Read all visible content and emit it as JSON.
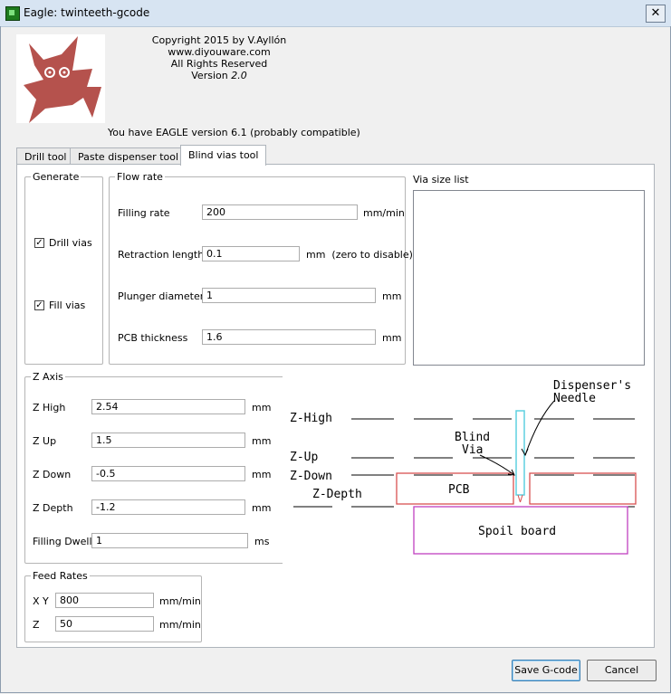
{
  "window": {
    "title": "Eagle: twinteeth-gcode",
    "close": "✕"
  },
  "header": {
    "copyright": "Copyright 2015 by V.Ayllón www.diyouware.com",
    "rights": "All Rights Reserved",
    "version_prefix": "Version",
    "version_number": "2.0",
    "eagle_status": "You have EAGLE version 6.1 (probably compatible)"
  },
  "tabs": [
    {
      "label": "Drill tool"
    },
    {
      "label": "Paste dispenser tool"
    },
    {
      "label": "Blind vias tool",
      "active": true
    }
  ],
  "generate": {
    "legend": "Generate",
    "drill_vias": {
      "label": "Drill vias",
      "checked": true
    },
    "fill_vias": {
      "label": "Fill vias",
      "checked": true
    }
  },
  "flow_rate": {
    "legend": "Flow rate",
    "filling_rate": {
      "label": "Filling rate",
      "value": "200",
      "unit": "mm/min"
    },
    "retraction_length": {
      "label": "Retraction length",
      "value": "0.1",
      "unit": "mm  (zero to disable)"
    },
    "plunger_diameter": {
      "label": "Plunger diameter",
      "value": "1",
      "unit": "mm"
    },
    "pcb_thickness": {
      "label": "PCB thickness",
      "value": "1.6",
      "unit": "mm"
    }
  },
  "via_list": {
    "label": "Via size list"
  },
  "z_axis": {
    "legend": "Z Axis",
    "z_high": {
      "label": "Z High",
      "value": "2.54",
      "unit": "mm"
    },
    "z_up": {
      "label": "Z Up",
      "value": "1.5",
      "unit": "mm"
    },
    "z_down": {
      "label": "Z Down",
      "value": "-0.5",
      "unit": "mm"
    },
    "z_depth": {
      "label": "Z Depth",
      "value": "-1.2",
      "unit": "mm"
    },
    "filling_dwell": {
      "label": "Filling Dwell",
      "value": "1",
      "unit": "ms"
    }
  },
  "feed_rates": {
    "legend": "Feed Rates",
    "xy": {
      "label": "X Y",
      "value": "800",
      "unit": "mm/min"
    },
    "z": {
      "label": "Z",
      "value": "50",
      "unit": "mm/min"
    }
  },
  "diagram": {
    "z_high": "Z-High",
    "z_up": "Z-Up",
    "z_down": "Z-Down",
    "z_depth": "Z-Depth",
    "dispenser_line1": "Dispenser's",
    "dispenser_line2": "Needle",
    "blind_line1": "Blind",
    "blind_line2": "Via",
    "pcb": "PCB",
    "spoil_board": "Spoil board",
    "colors": {
      "needle": "#5fd0e0",
      "pcb": "#d95050",
      "spoil": "#c040c0"
    }
  },
  "buttons": {
    "save": "Save G-code",
    "cancel": "Cancel"
  },
  "colors": {
    "logo": "#b5524d"
  }
}
